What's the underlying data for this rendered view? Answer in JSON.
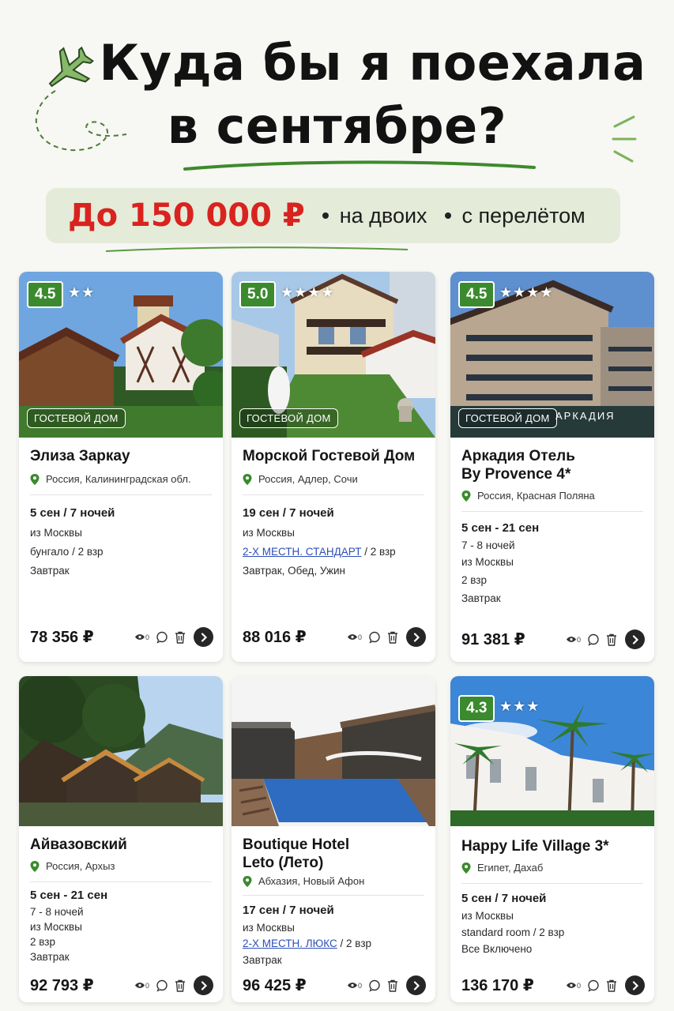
{
  "header": {
    "title_line1": "Куда бы я поехала",
    "title_line2": "в сентябре?",
    "budget_price": "До 150 000 ₽",
    "tag1": "на двоих",
    "tag2": "с перелётом"
  },
  "colors": {
    "accent_green": "#3b8a2e",
    "price_red": "#d8231f",
    "badge_bg": "#e4ebd8"
  },
  "cards": [
    {
      "rating": "4.5",
      "stars": "★★",
      "type": "ГОСТЕВОЙ ДОМ",
      "name": "Элиза Заркау",
      "location": "Россия, Калининградская обл.",
      "dates": "5 сен / 7 ночей",
      "from": "из Москвы",
      "room": "бунгало / 2 взр",
      "meal": "Завтрак",
      "price": "78 356 ₽",
      "views": "0"
    },
    {
      "rating": "5.0",
      "stars": "★★★★",
      "type": "ГОСТЕВОЙ ДОМ",
      "name": "Морской Гостевой Дом",
      "location": "Россия, Адлер, Сочи",
      "dates": "19 сен / 7 ночей",
      "from": "из Москвы",
      "room_link": "2-Х МЕСТН. СТАНДАРТ",
      "room_rest": " / 2 взр",
      "meal": "Завтрак, Обед, Ужин",
      "price": "88 016 ₽",
      "views": "0"
    },
    {
      "rating": "4.5",
      "stars": "★★★★",
      "type": "ГОСТЕВОЙ ДОМ",
      "sign": "АРКАДИЯ",
      "name_line1": "Аркадия Отель",
      "name_line2": "By Provence 4*",
      "location": "Россия, Красная Поляна",
      "dates": "5 сен - 21 сен",
      "nights": "7 - 8 ночей",
      "from": "из Москвы",
      "room": "2 взр",
      "meal": "Завтрак",
      "price": "91 381 ₽",
      "views": "0"
    },
    {
      "name": "Айвазовский",
      "location": "Россия, Архыз",
      "dates": "5 сен - 21 сен",
      "nights": "7 - 8 ночей",
      "from": "из Москвы",
      "room": "2 взр",
      "meal": "Завтрак",
      "price": "92 793 ₽",
      "views": "0"
    },
    {
      "name_line1": "Boutique Hotel",
      "name_line2": "Leto (Лето)",
      "location": "Абхазия, Новый Афон",
      "dates": "17 сен / 7 ночей",
      "from": "из Москвы",
      "room_link": "2-Х МЕСТН. ЛЮКС",
      "room_rest": " / 2 взр",
      "meal": "Завтрак",
      "price": "96 425 ₽",
      "views": "0"
    },
    {
      "rating": "4.3",
      "stars": "★★★",
      "name": "Happy Life Village 3*",
      "location": "Египет, Дахаб",
      "dates": "5 сен / 7 ночей",
      "from": "из Москвы",
      "room": "standard room / 2 взр",
      "meal": "Все Включено",
      "price": "136 170 ₽",
      "views": "0"
    }
  ]
}
